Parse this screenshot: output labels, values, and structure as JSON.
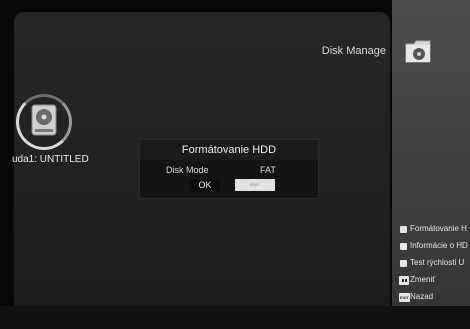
{
  "header": {
    "title": "Disk Manage"
  },
  "device": {
    "label": "uda1: UNTITLED"
  },
  "dialog": {
    "title": "Formátovanie HDD",
    "mode_label": "Disk Mode",
    "mode_value": "FAT",
    "ok_label": "OK",
    "exit_label": "EXIT"
  },
  "menu": {
    "items": [
      {
        "label": "Formátovanie H",
        "icon": "square-bullet-icon"
      },
      {
        "label": "Informácie o HD",
        "icon": "square-bullet-icon"
      },
      {
        "label": "Test rýchlosti U",
        "icon": "square-bullet-icon"
      },
      {
        "label": "Zmeniť",
        "icon": "left-right-key-icon"
      },
      {
        "label": "Nazad",
        "icon": "exit-key-icon",
        "key_text": "EXIT"
      }
    ]
  },
  "colors": {
    "panel": "#242424",
    "right_strip": "#464646",
    "dialog": "#141414",
    "text": "#e6e6e6",
    "exit_button": "#e2e2e2"
  }
}
